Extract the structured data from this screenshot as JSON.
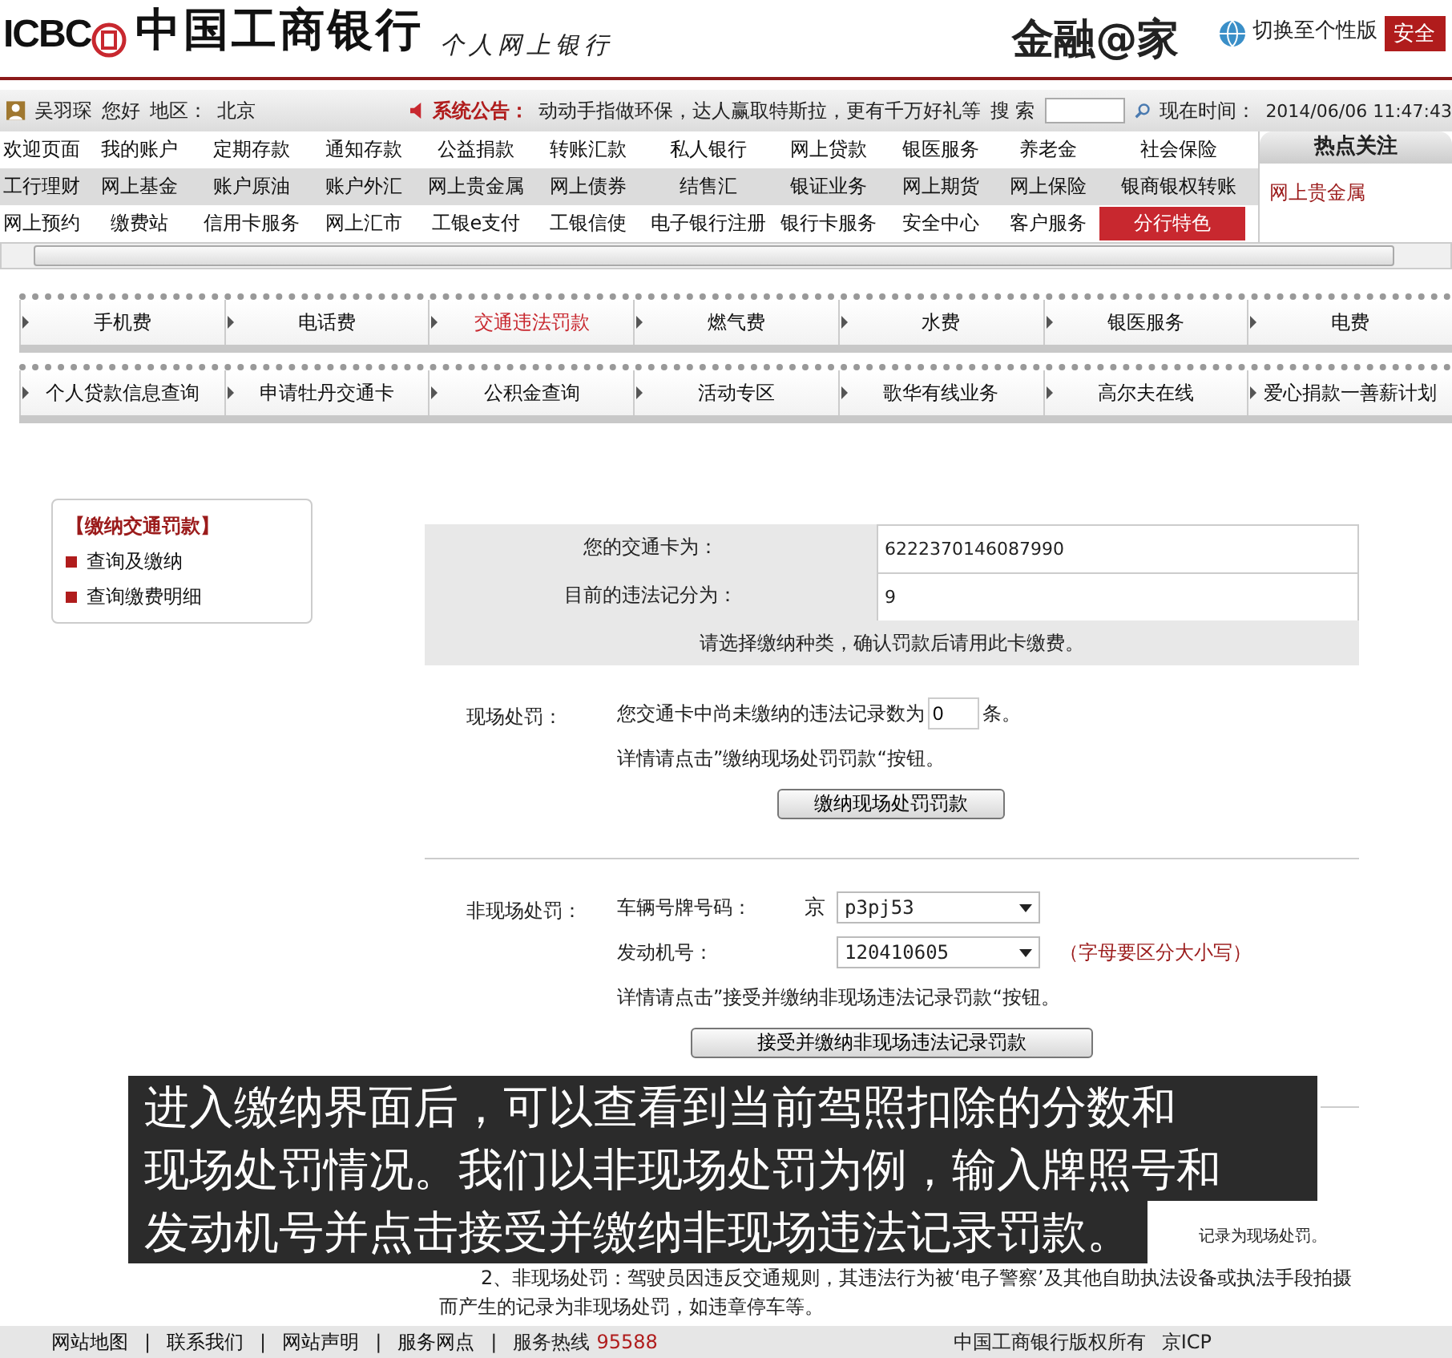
{
  "header": {
    "logo_text": "ICBC",
    "bank_name": "中国工商银行",
    "product": "个人网上银行",
    "slogan": "金融@家",
    "switch_link": "切换至个性版",
    "logout_button": "安全"
  },
  "user_bar": {
    "user": "吴羽琛",
    "greeting": "您好",
    "region_label": "地区：",
    "region": "北京",
    "notice_label": "系统公告：",
    "notice": "动动手指做环保，达人赢取特斯拉，更有千万好礼等",
    "search_label": "搜 索",
    "time_label": "现在时间：",
    "time": "2014/06/06 11:47:43"
  },
  "menu": [
    [
      {
        "label": "欢迎页面",
        "selected": false
      },
      {
        "label": "我的账户",
        "selected": false
      },
      {
        "label": "定期存款",
        "selected": false
      },
      {
        "label": "通知存款",
        "selected": false
      },
      {
        "label": "公益捐款",
        "selected": false
      },
      {
        "label": "转账汇款",
        "selected": false
      },
      {
        "label": "私人银行",
        "selected": false
      },
      {
        "label": "网上贷款",
        "selected": false
      },
      {
        "label": "银医服务",
        "selected": false
      },
      {
        "label": "养老金",
        "selected": false
      },
      {
        "label": "社会保险",
        "selected": false
      }
    ],
    [
      {
        "label": "工行理财",
        "selected": false
      },
      {
        "label": "网上基金",
        "selected": false
      },
      {
        "label": "账户原油",
        "selected": false
      },
      {
        "label": "账户外汇",
        "selected": false
      },
      {
        "label": "网上贵金属",
        "selected": false
      },
      {
        "label": "网上债券",
        "selected": false
      },
      {
        "label": "结售汇",
        "selected": false
      },
      {
        "label": "银证业务",
        "selected": false
      },
      {
        "label": "网上期货",
        "selected": false
      },
      {
        "label": "网上保险",
        "selected": false
      },
      {
        "label": "银商银权转账",
        "selected": false
      }
    ],
    [
      {
        "label": "网上预约",
        "selected": false
      },
      {
        "label": "缴费站",
        "selected": false
      },
      {
        "label": "信用卡服务",
        "selected": false
      },
      {
        "label": "网上汇市",
        "selected": false
      },
      {
        "label": "工银e支付",
        "selected": false
      },
      {
        "label": "工银信使",
        "selected": false
      },
      {
        "label": "电子银行注册",
        "selected": false
      },
      {
        "label": "银行卡服务",
        "selected": false
      },
      {
        "label": "安全中心",
        "selected": false
      },
      {
        "label": "客户服务",
        "selected": false
      },
      {
        "label": "分行特色",
        "selected": true
      }
    ]
  ],
  "hot_topics": {
    "title": "热点关注",
    "items": [
      "网上贵金属"
    ]
  },
  "service_tabs": [
    [
      {
        "label": "手机费",
        "selected": false
      },
      {
        "label": "电话费",
        "selected": false
      },
      {
        "label": "交通违法罚款",
        "selected": true
      },
      {
        "label": "燃气费",
        "selected": false
      },
      {
        "label": "水费",
        "selected": false
      },
      {
        "label": "银医服务",
        "selected": false
      },
      {
        "label": "电费",
        "selected": false
      }
    ],
    [
      {
        "label": "个人贷款信息查询",
        "selected": false
      },
      {
        "label": "申请牡丹交通卡",
        "selected": false
      },
      {
        "label": "公积金查询",
        "selected": false
      },
      {
        "label": "活动专区",
        "selected": false
      },
      {
        "label": "歌华有线业务",
        "selected": false
      },
      {
        "label": "高尔夫在线",
        "selected": false
      },
      {
        "label": "爱心捐款一善薪计划",
        "selected": false
      }
    ]
  ],
  "side_menu": {
    "title": "【缴纳交通罚款】",
    "items": [
      "查询及缴纳",
      "查询缴费明细"
    ]
  },
  "card_info": {
    "rows": [
      {
        "label": "您的交通卡为：",
        "value": "6222370146087990"
      },
      {
        "label": "目前的违法记分为：",
        "value": "9"
      }
    ],
    "note": "请选择缴纳种类，确认罚款后请用此卡缴费。"
  },
  "onsite": {
    "label": "现场处罚：",
    "text_before": "您交通卡中尚未缴纳的违法记录数为",
    "count": "0",
    "text_after": "条。",
    "hint": "详情请点击”缴纳现场处罚罚款“按钮。",
    "button": "缴纳现场处罚罚款"
  },
  "offsite": {
    "label": "非现场处罚：",
    "plate_label": "车辆号牌号码：",
    "plate_prefix": "京",
    "plate": "p3pj53",
    "engine_label": "发动机号：",
    "engine": "120410605",
    "case_note": "（字母要区分大小写）",
    "hint": "详情请点击”接受并缴纳非现场违法记录罚款“按钮。",
    "button": "接受并缴纳非现场违法记录罚款"
  },
  "caption_lines": [
    "进入缴纳界面后，可以查看到当前驾照扣除的分数和",
    "现场处罚情况。我们以非现场处罚为例，输入牌照号和",
    "发动机号并点击接受并缴纳非现场违法记录罚款。"
  ],
  "notes": [
    "记录为现场处罚。",
    "2、非现场处罚：驾驶员因违反交通规则，其违法行为被‘电子警察’及其他自助执法设备或执法手段拍摄而产生的记录为非现场处罚，如违章停车等。"
  ],
  "footer": {
    "links": [
      "网站地图",
      "联系我们",
      "网站声明",
      "服务网点"
    ],
    "separator": "|",
    "hotline_label": "服务热线",
    "hotline": "95588",
    "copyright": "中国工商银行版权所有",
    "icp": "京ICP"
  }
}
